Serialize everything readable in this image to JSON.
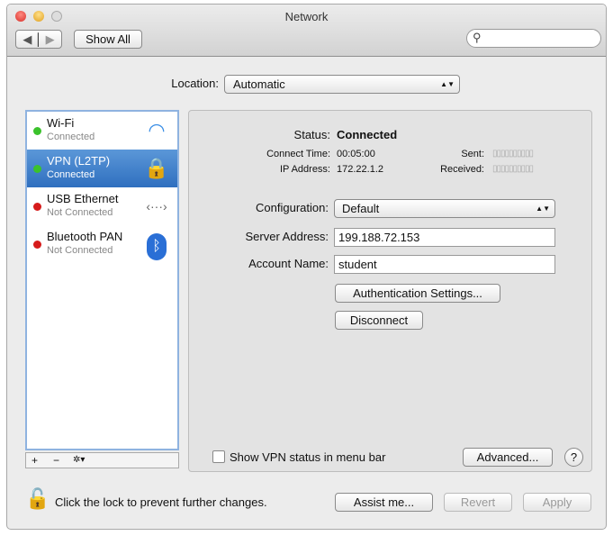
{
  "window": {
    "title": "Network",
    "show_all": "Show All",
    "search_placeholder": ""
  },
  "location": {
    "label": "Location:",
    "value": "Automatic"
  },
  "services": [
    {
      "name": "Wi-Fi",
      "status": "Connected",
      "color": "#3bc22c",
      "icon": "wifi-icon"
    },
    {
      "name": "VPN (L2TP)",
      "status": "Connected",
      "color": "#3bc22c",
      "icon": "lock-icon"
    },
    {
      "name": "USB Ethernet",
      "status": "Not Connected",
      "color": "#d61b1b",
      "icon": "ethernet-icon"
    },
    {
      "name": "Bluetooth PAN",
      "status": "Not Connected",
      "color": "#d61b1b",
      "icon": "bluetooth-icon"
    }
  ],
  "detail": {
    "status_label": "Status:",
    "status_value": "Connected",
    "connect_time_label": "Connect Time:",
    "connect_time": "00:05:00",
    "ip_label": "IP Address:",
    "ip": "172.22.1.2",
    "sent_label": "Sent:",
    "received_label": "Received:",
    "config_label": "Configuration:",
    "config_value": "Default",
    "server_label": "Server Address:",
    "server_value": "199.188.72.153",
    "account_label": "Account Name:",
    "account_value": "student",
    "auth_button": "Authentication Settings...",
    "disconnect_button": "Disconnect",
    "show_status_label": "Show VPN status in menu bar",
    "advanced_button": "Advanced...",
    "help": "?"
  },
  "footer": {
    "lock_text": "Click the lock to prevent further changes.",
    "assist": "Assist me...",
    "revert": "Revert",
    "apply": "Apply"
  },
  "toolbar": {
    "add": "+",
    "remove": "−",
    "gear": "✲▾"
  }
}
